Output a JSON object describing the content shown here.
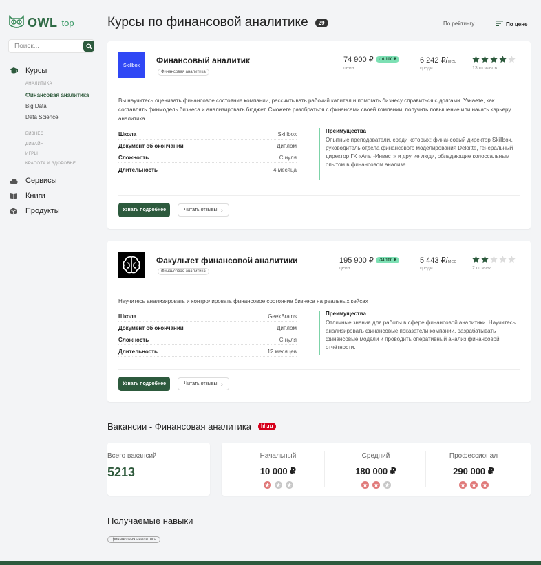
{
  "brand": {
    "name": "OWL",
    "sub": "top"
  },
  "search": {
    "placeholder": "Поиск..."
  },
  "nav": {
    "courses": "Курсы",
    "sub_items": [
      {
        "label": "АНАЛИТИКА"
      },
      {
        "label": "Финансовая аналитика"
      },
      {
        "label": "Big Data"
      },
      {
        "label": "Data Science"
      }
    ],
    "categories": [
      "БИЗНЕС",
      "ДИЗАЙН",
      "ИГРЫ",
      "КРАСОТА И ЗДОРОВЬЕ"
    ],
    "services": "Сервисы",
    "books": "Книги",
    "products": "Продукты"
  },
  "header": {
    "title": "Курсы по финансовой аналитике",
    "count": "29",
    "sort_rating": "По рейтингу",
    "sort_price": "По цене"
  },
  "courses": [
    {
      "logo_text": "Skillbox",
      "logo_color": "#2f47f5",
      "title": "Финансовый аналитик",
      "tag": "Финансовая аналитика",
      "price": "74 900 ₽",
      "discount": "-16 100 ₽",
      "price_label": "цена",
      "credit": "6 242 ₽/",
      "credit_unit": "мес",
      "credit_label": "кредит",
      "rating": 4,
      "reviews": "13 отзывов",
      "description": "Вы научитесь оценивать финансовое состояние компании, рассчитывать рабочий капитал и помогать бизнесу справиться с долгами. Узнаете, как составлять финмодель бизнеса и анализировать бюджет. Сможете разобраться с финансами своей компании, получить повышение или начать карьеру аналитика.",
      "specs": [
        {
          "k": "Школа",
          "v": "Skillbox"
        },
        {
          "k": "Документ об окончании",
          "v": "Диплом"
        },
        {
          "k": "Сложность",
          "v": "С нуля"
        },
        {
          "k": "Длительность",
          "v": "4 месяца"
        }
      ],
      "adv_title": "Преимущества",
      "adv_text": "Опытные преподаватели, среди которых: финансовый директор Skillbox, руководитель отдела финансового моделирования Deloitte, генеральный директор ГК «Альт-Инвест» и другие люди, обладающие колоссальным опытом в финансовом анализе.",
      "btn_more": "Узнать подробнее",
      "btn_reviews": "Читать отзывы"
    },
    {
      "logo_text": "",
      "logo_color": "#000000",
      "title": "Факультет финансовой аналитики",
      "tag": "Финансовая аналитика",
      "price": "195 900 ₽",
      "discount": "-34 100 ₽",
      "price_label": "цена",
      "credit": "5 443 ₽/",
      "credit_unit": "мес",
      "credit_label": "кредит",
      "rating": 2,
      "reviews": "2 отзыва",
      "description": "Научитесь анализировать и контролировать финансовое состояние бизнеса на реальных кейсах",
      "specs": [
        {
          "k": "Школа",
          "v": "GeekBrains"
        },
        {
          "k": "Документ об окончании",
          "v": "Диплом"
        },
        {
          "k": "Сложность",
          "v": "С нуля"
        },
        {
          "k": "Длительность",
          "v": "12 месяцев"
        }
      ],
      "adv_title": "Преимущества",
      "adv_text": "Отличные знания для работы в сфере финансовой аналитики. Научитесь анализировать финансовые показатели компании, разрабатывать финансовые модели и проводить оперативный анализ финансовой отчётности.",
      "btn_more": "Узнать подробнее",
      "btn_reviews": "Читать отзывы"
    }
  ],
  "vacancies": {
    "title": "Вакансии - Финансовая аналитика",
    "badge": "hh.ru",
    "total_label": "Всего вакансий",
    "total": "5213",
    "levels": [
      {
        "label": "Начальный",
        "salary": "10 000 ₽",
        "level": 1
      },
      {
        "label": "Средний",
        "salary": "180 000 ₽",
        "level": 2
      },
      {
        "label": "Профессионал",
        "salary": "290 000 ₽",
        "level": 3
      }
    ]
  },
  "skills": {
    "title": "Получаемые навыки",
    "items": [
      "финансовая аналитика"
    ]
  },
  "colors": {
    "accent": "#2d5a3d",
    "star": "#2d5a3d",
    "discount": "#7de0b4",
    "advantage_border": "#7dd3a8"
  }
}
